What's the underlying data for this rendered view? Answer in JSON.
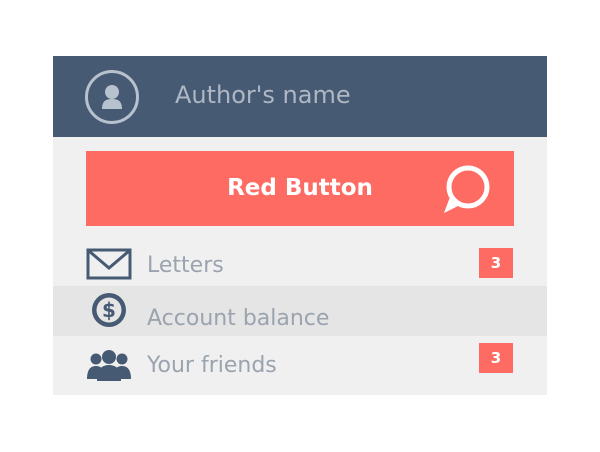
{
  "header": {
    "author_name": "Author's name",
    "avatar_icon": "user-avatar-icon"
  },
  "red_button": {
    "label": "Red Button",
    "icon": "chat-bubble-icon",
    "color": "#fd6b63"
  },
  "menu": {
    "items": [
      {
        "label": "Letters",
        "icon": "envelope-icon",
        "badge": "3"
      },
      {
        "label": "Account balance",
        "icon": "dollar-icon",
        "badge": ""
      },
      {
        "label": "Your friends",
        "icon": "friends-icon",
        "badge": "3"
      }
    ]
  },
  "colors": {
    "header": "#475a73",
    "accent": "#fd6b63",
    "panel": "#f0f0f0"
  }
}
